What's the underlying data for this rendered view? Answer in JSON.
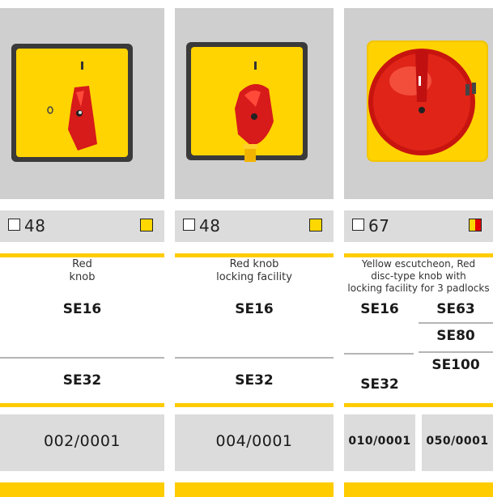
{
  "products": [
    {
      "dimension": "48",
      "description_lines": [
        "Red",
        "knob"
      ],
      "codes": [
        "SE16",
        "SE32"
      ],
      "article": "002/0001",
      "color_icon": "yellow-square-icon"
    },
    {
      "dimension": "48",
      "description_lines": [
        "Red knob",
        "locking facility"
      ],
      "codes": [
        "SE16",
        "SE32"
      ],
      "article": "004/0001",
      "color_icon": "yellow-square-icon"
    },
    {
      "dimension": "67",
      "description_lines": [
        "Yellow escutcheon, Red",
        "disc-type knob with",
        "locking facility for 3 padlocks"
      ],
      "codes_left": [
        "SE16",
        "SE32"
      ],
      "codes_right": [
        "SE63",
        "SE80",
        "SE100"
      ],
      "articles": [
        "010/0001",
        "050/0001"
      ],
      "color_icon": "yellow-red-square-icon"
    }
  ],
  "colors": {
    "yellow": "#ffd800",
    "accent_bar": "#ffcc00",
    "red": "#e30000",
    "panel_gray": "#dcdcdc"
  }
}
